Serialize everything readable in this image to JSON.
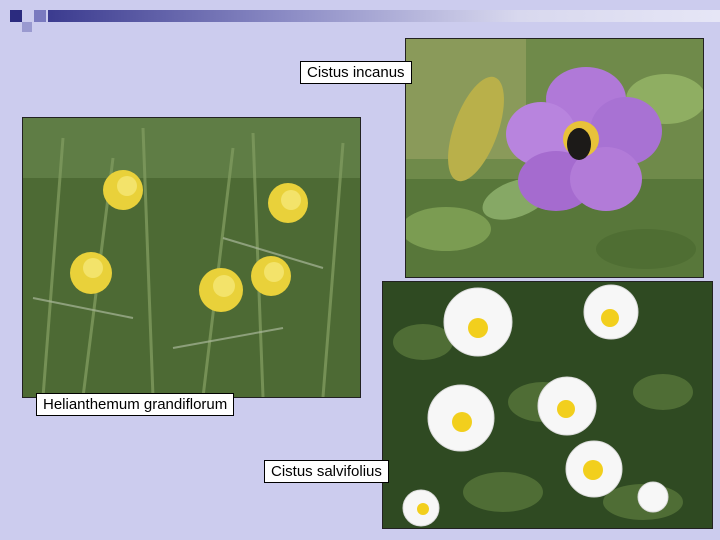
{
  "slide": {
    "background": "#ccccee",
    "accent": "#2b2b7f"
  },
  "photos": [
    {
      "caption": "Cistus incanus",
      "subject": "purple-rockrose-with-bee"
    },
    {
      "caption": "Helianthemum grandiflorum",
      "subject": "yellow-rockrose-cluster"
    },
    {
      "caption": "Cistus salvifolius",
      "subject": "white-rockrose-cluster"
    }
  ]
}
